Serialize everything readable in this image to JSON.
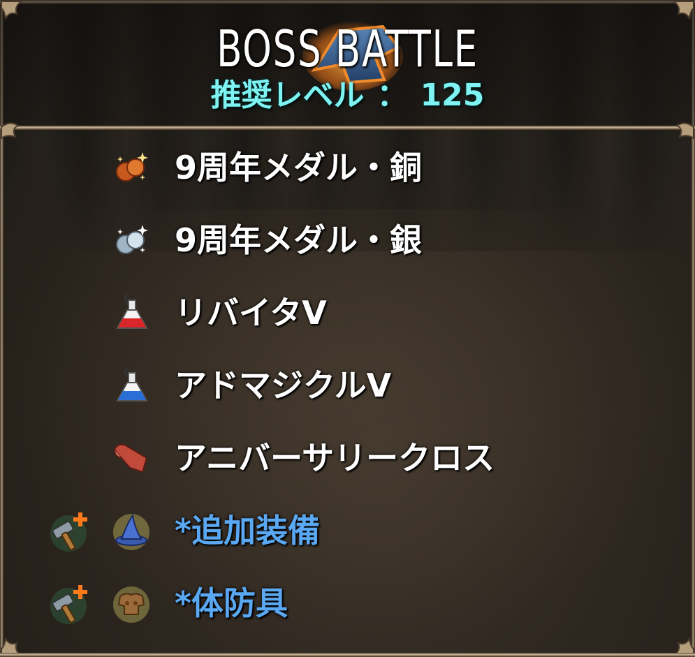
{
  "header": {
    "title": "BOSS BATTLE",
    "level_label": "推奨レベル",
    "level_separator": "：",
    "level_value": "125"
  },
  "rewards": [
    {
      "label": "9周年メダル・銅",
      "icon": "bronze-medal-icon"
    },
    {
      "label": "9周年メダル・銀",
      "icon": "silver-medal-icon"
    },
    {
      "label": "リバイタV",
      "icon": "red-potion-icon"
    },
    {
      "label": "アドマジクルV",
      "icon": "blue-potion-icon"
    },
    {
      "label": "アニバーサリークロス",
      "icon": "cloth-icon"
    },
    {
      "label": "*追加装備",
      "icon": "wizard-hat-icon",
      "extra_icon": "hammer-plus-icon"
    },
    {
      "label": "*体防具",
      "icon": "body-armor-icon",
      "extra_icon": "hammer-plus-icon"
    }
  ],
  "colors": {
    "level": "#7ff2f2",
    "optional_label": "#5aa8f2",
    "label": "#ffffff"
  }
}
